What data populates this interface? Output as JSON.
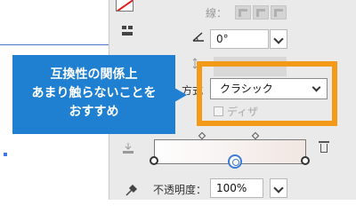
{
  "colors": {
    "callout_bg": "#1f7fd0",
    "highlight_frame": "#f39a18",
    "selection_line": "#4a78c8"
  },
  "stroke": {
    "label": "線：",
    "options": [
      "miter-join",
      "round-join",
      "bevel-join"
    ]
  },
  "angle": {
    "icon": "angle-icon",
    "value": "0°"
  },
  "method": {
    "label": "方式",
    "value": "クラシック"
  },
  "dither": {
    "label": "ディザ",
    "checked": false
  },
  "callout": {
    "lines": [
      "互換性の関係上",
      "あまり触らないことを",
      "おすすめ"
    ]
  },
  "opacity": {
    "label": "不透明度：",
    "value": "100%"
  },
  "gradient": {
    "stops": [
      "#fefefe",
      "#f0e6e2"
    ],
    "active_stop": "midpoint"
  }
}
